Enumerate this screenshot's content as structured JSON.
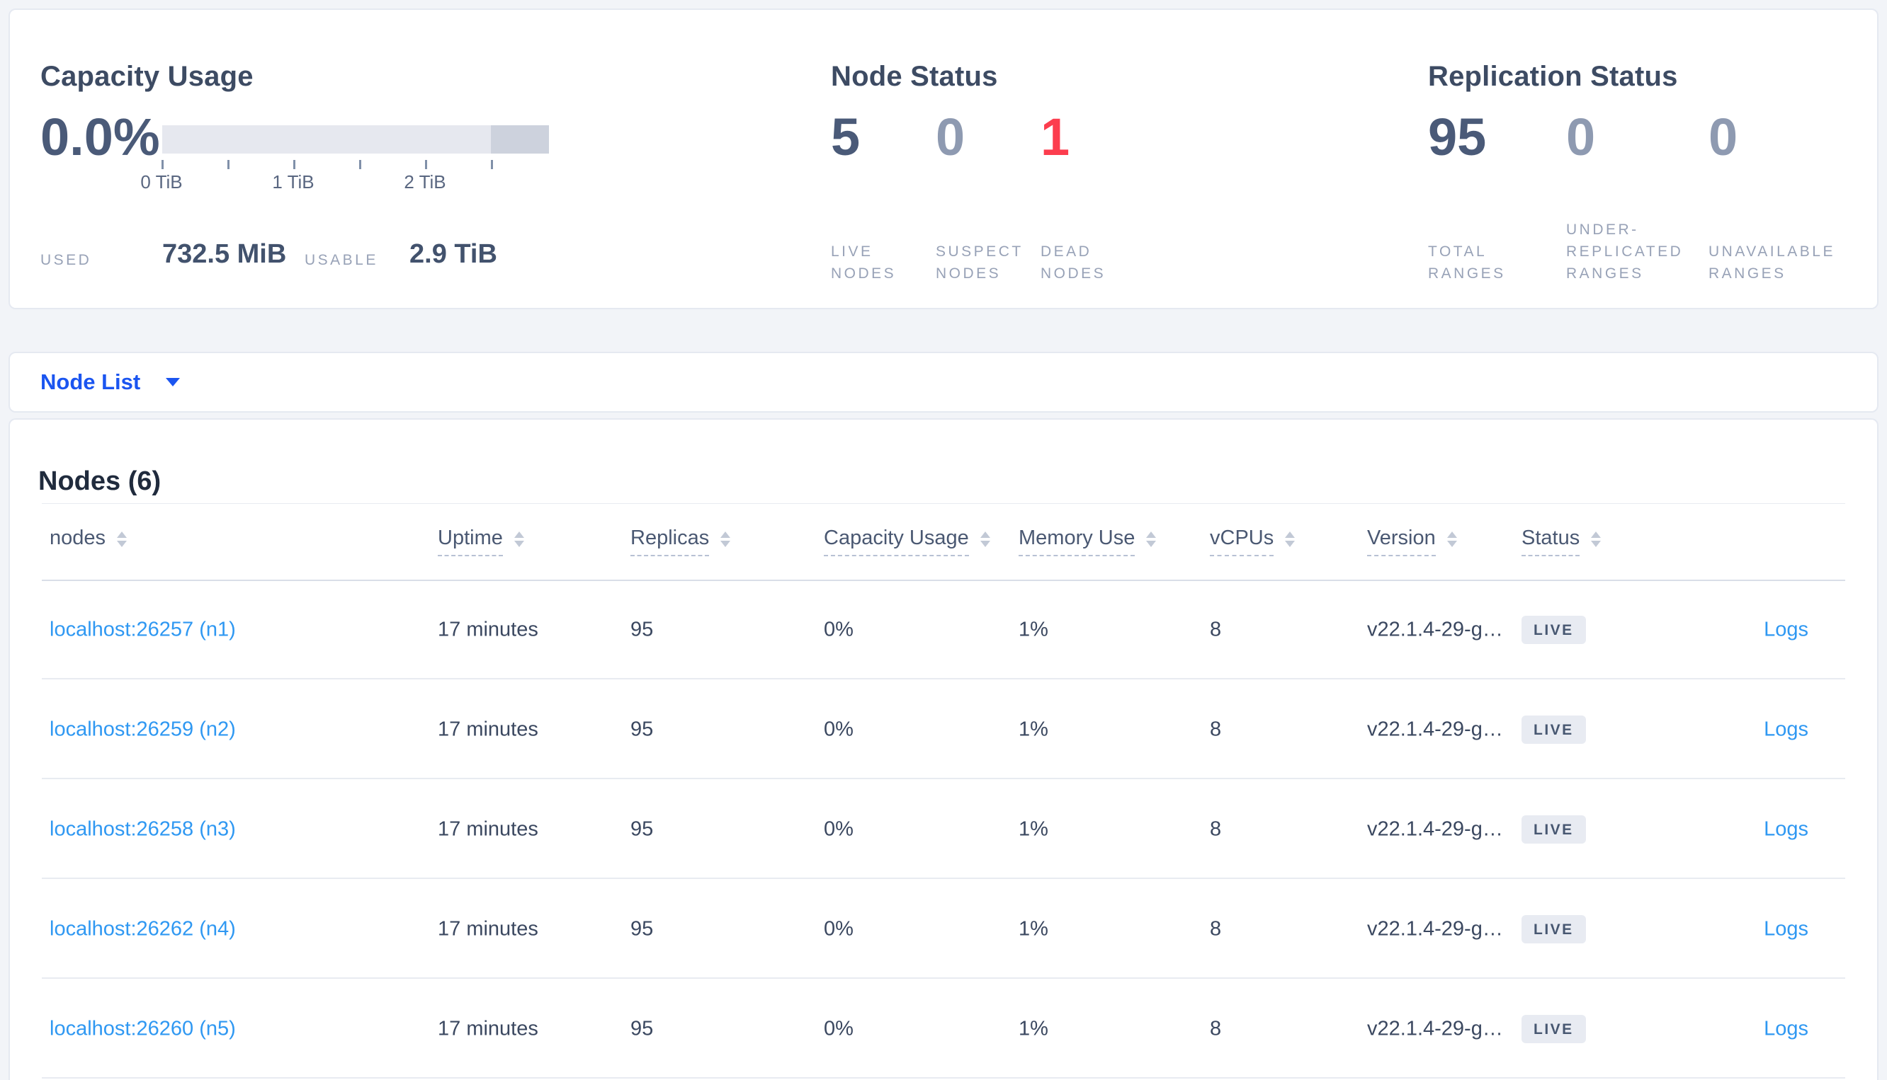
{
  "summary": {
    "capacity": {
      "title": "Capacity Usage",
      "percent": "0.0%",
      "tick_labels": [
        "0 TiB",
        "1 TiB",
        "2 TiB"
      ],
      "used_label": "USED",
      "used_value": "732.5 MiB",
      "usable_label": "USABLE",
      "usable_value": "2.9 TiB"
    },
    "node_status": {
      "title": "Node Status",
      "stats": [
        {
          "value": "5",
          "line1": "LIVE",
          "line2": "NODES"
        },
        {
          "value": "0",
          "line1": "SUSPECT",
          "line2": "NODES"
        },
        {
          "value": "1",
          "line1": "DEAD",
          "line2": "NODES"
        }
      ]
    },
    "replication_status": {
      "title": "Replication Status",
      "stats": [
        {
          "value": "95",
          "line1": "TOTAL",
          "line2": "RANGES"
        },
        {
          "value": "0",
          "line1": "UNDER-",
          "line2": "REPLICATED",
          "line3": "RANGES"
        },
        {
          "value": "0",
          "line1": "UNAVAILABLE",
          "line2": "RANGES"
        }
      ]
    }
  },
  "view_selector": {
    "label": "Node List"
  },
  "table": {
    "title": "Nodes (6)",
    "logs_label": "Logs",
    "columns": [
      {
        "label": "nodes"
      },
      {
        "label": "Uptime"
      },
      {
        "label": "Replicas"
      },
      {
        "label": "Capacity Usage"
      },
      {
        "label": "Memory Use"
      },
      {
        "label": "vCPUs"
      },
      {
        "label": "Version"
      },
      {
        "label": "Status"
      }
    ],
    "rows": [
      {
        "node": "localhost:26257 (n1)",
        "uptime": "17 minutes",
        "replicas": "95",
        "capacity_usage": "0%",
        "memory_use": "1%",
        "vcpus": "8",
        "version": "v22.1.4-29-g…",
        "status": "LIVE"
      },
      {
        "node": "localhost:26259 (n2)",
        "uptime": "17 minutes",
        "replicas": "95",
        "capacity_usage": "0%",
        "memory_use": "1%",
        "vcpus": "8",
        "version": "v22.1.4-29-g…",
        "status": "LIVE"
      },
      {
        "node": "localhost:26258 (n3)",
        "uptime": "17 minutes",
        "replicas": "95",
        "capacity_usage": "0%",
        "memory_use": "1%",
        "vcpus": "8",
        "version": "v22.1.4-29-g…",
        "status": "LIVE"
      },
      {
        "node": "localhost:26262 (n4)",
        "uptime": "17 minutes",
        "replicas": "95",
        "capacity_usage": "0%",
        "memory_use": "1%",
        "vcpus": "8",
        "version": "v22.1.4-29-g…",
        "status": "LIVE"
      },
      {
        "node": "localhost:26260 (n5)",
        "uptime": "17 minutes",
        "replicas": "95",
        "capacity_usage": "0%",
        "memory_use": "1%",
        "vcpus": "8",
        "version": "v22.1.4-29-g…",
        "status": "LIVE"
      }
    ]
  },
  "colors": {
    "accent_blue": "#1b55f0",
    "link_blue": "#2f98f2",
    "dead_red": "#fc3d4e",
    "stat_dark": "#4a5a78",
    "stat_muted": "#8e9ab1",
    "badge_bg": "#e8ebf2"
  }
}
